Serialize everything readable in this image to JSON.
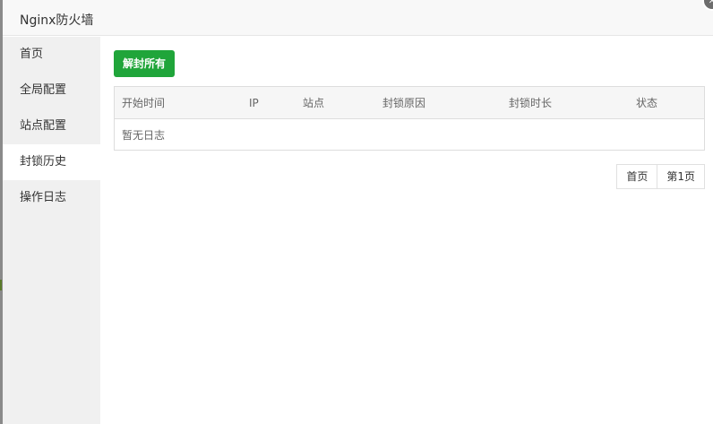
{
  "window": {
    "title": "Nginx防火墙"
  },
  "sidebar": {
    "items": [
      {
        "label": "首页"
      },
      {
        "label": "全局配置"
      },
      {
        "label": "站点配置"
      },
      {
        "label": "封锁历史"
      },
      {
        "label": "操作日志"
      }
    ],
    "active_index": 3
  },
  "main": {
    "unlock_all_label": "解封所有",
    "table": {
      "headers": [
        "开始时间",
        "IP",
        "站点",
        "封锁原因",
        "封锁时长",
        "状态"
      ],
      "empty_text": "暂无日志"
    },
    "pagination": {
      "first_label": "首页",
      "current_label": "第1页"
    }
  },
  "colors": {
    "accent": "#20a53a",
    "sidebar_bg": "#f0f0f0"
  },
  "icons": {
    "close": "close-icon"
  }
}
